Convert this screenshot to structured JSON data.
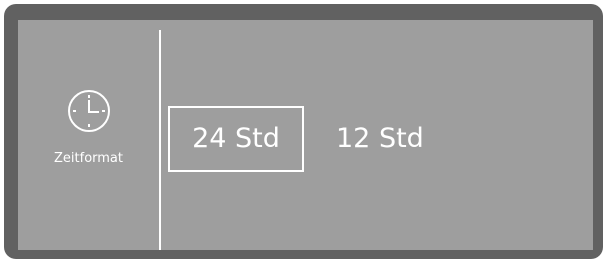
{
  "sidebar": {
    "icon": "clock-icon",
    "label": "Zeitformat"
  },
  "options": [
    {
      "label": "24 Std",
      "selected": true
    },
    {
      "label": "12 Std",
      "selected": false
    }
  ],
  "colors": {
    "frame": "#616161",
    "screen": "#9e9e9e",
    "foreground": "#ffffff"
  }
}
